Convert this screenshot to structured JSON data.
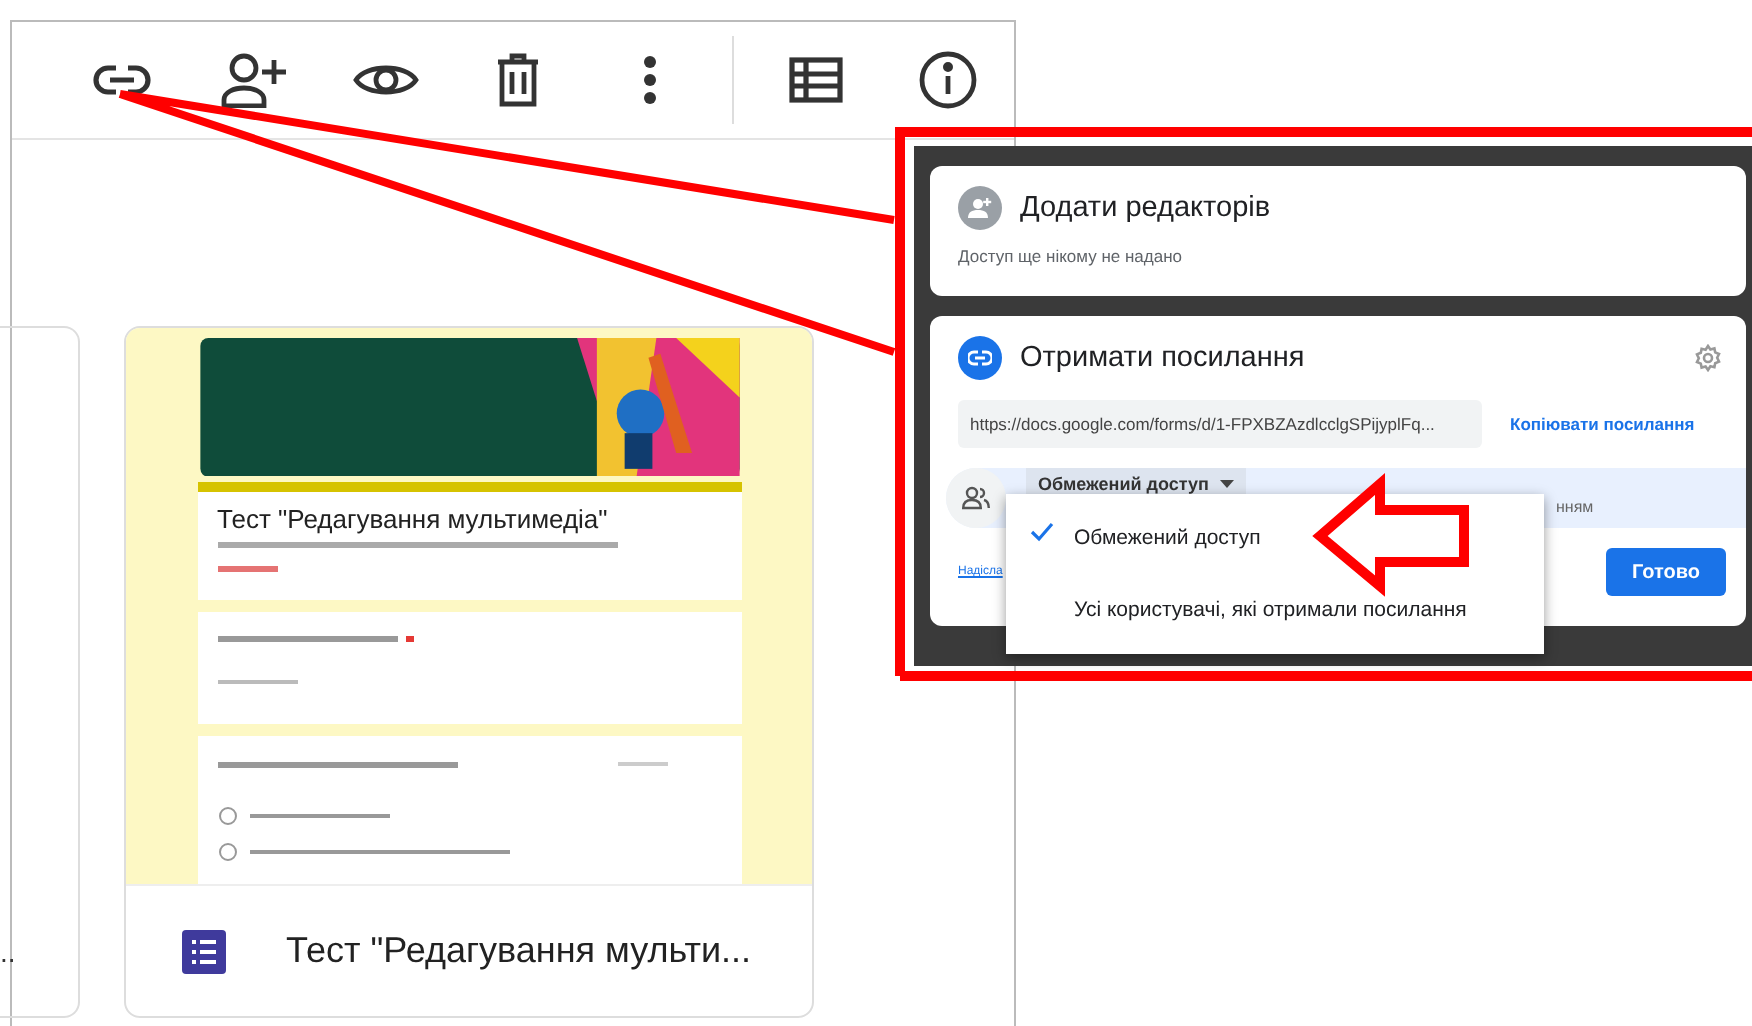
{
  "toolbar": {
    "buttons": [
      {
        "kind": "link"
      },
      {
        "kind": "add-person"
      },
      {
        "kind": "preview"
      },
      {
        "kind": "delete"
      },
      {
        "kind": "more"
      },
      {
        "kind": "divider"
      },
      {
        "kind": "responses"
      },
      {
        "kind": "info"
      }
    ]
  },
  "left_card": {
    "text": ".."
  },
  "form_card": {
    "preview_title": "Тест \"Редагування мультимедіа\"",
    "title": "Тест \"Редагування мульти..."
  },
  "share_dialog": {
    "editors": {
      "title": "Додати редакторів",
      "subtitle": "Доступ ще нікому не надано"
    },
    "link": {
      "title": "Отримати посилання",
      "url": "https://docs.google.com/forms/d/1-FPXBZAzdlcclgSPijyplFq...",
      "copy": "Копіювати посилання",
      "access_button": "Обмежений доступ",
      "access_note": "нням",
      "send_link": "Надісла",
      "done": "Готово"
    },
    "menu": {
      "items": [
        {
          "label": "Обмежений доступ",
          "selected": true
        },
        {
          "label": "Усі користувачі, які отримали посилання",
          "selected": false
        }
      ]
    }
  }
}
